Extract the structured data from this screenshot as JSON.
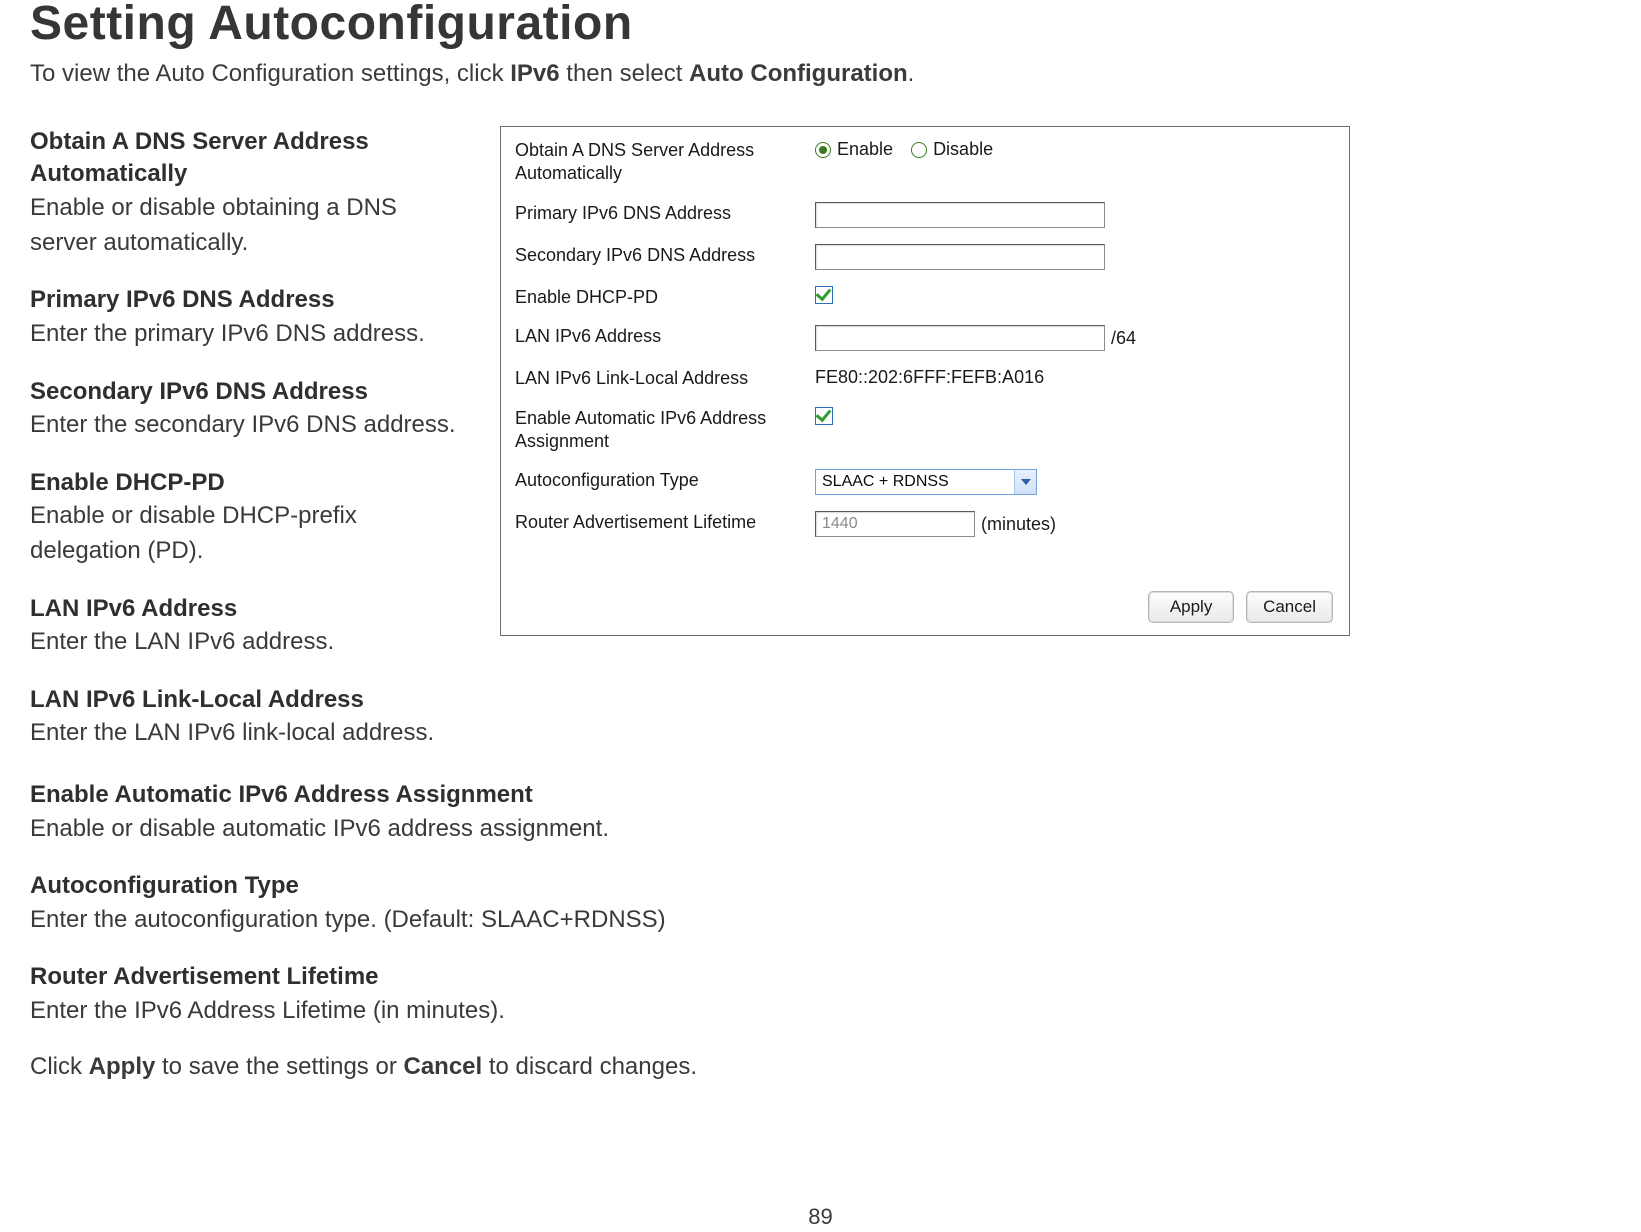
{
  "page": {
    "title": "Setting Autoconfiguration",
    "intro_prefix": "To view the Auto Configuration settings, click ",
    "intro_bold1": "IPv6",
    "intro_mid": " then select ",
    "intro_bold2": "Auto Configuration",
    "intro_suffix": ".",
    "page_number": "89"
  },
  "defs": {
    "d1_term": "Obtain A DNS Server Address Automatically",
    "d1_desc": "Enable or disable obtaining a DNS server automatically.",
    "d2_term": "Primary IPv6 DNS Address",
    "d2_desc": "Enter the primary IPv6 DNS address.",
    "d3_term": "Secondary IPv6 DNS Address",
    "d3_desc": "Enter the secondary IPv6 DNS address.",
    "d4_term": "Enable DHCP-PD",
    "d4_desc": "Enable or disable DHCP-prefix delegation (PD).",
    "d5_term": "LAN IPv6 Address",
    "d5_desc": "Enter the LAN IPv6 address.",
    "d6_term": "LAN IPv6 Link-Local Address",
    "d6_desc": "Enter the LAN IPv6 link-local address.",
    "d7_term": "Enable Automatic IPv6 Address Assignment",
    "d7_desc": "Enable or disable automatic IPv6 address assignment.",
    "d8_term": "Autoconfiguration Type",
    "d8_desc": "Enter the autoconfiguration type. (Default: SLAAC+RDNSS)",
    "d9_term": "Router Advertisement Lifetime",
    "d9_desc": "Enter the IPv6 Address Lifetime (in minutes)."
  },
  "footer": {
    "prefix": "Click ",
    "b1": "Apply",
    "mid": " to save the settings or ",
    "b2": "Cancel",
    "suffix": " to discard changes."
  },
  "panel": {
    "rows": {
      "obtain_dns_label": "Obtain A DNS Server Address Automatically",
      "radio_enable": "Enable",
      "radio_disable": "Disable",
      "primary_dns_label": "Primary IPv6 DNS Address",
      "primary_dns_value": "",
      "secondary_dns_label": "Secondary IPv6 DNS Address",
      "secondary_dns_value": "",
      "enable_dhcp_pd_label": "Enable DHCP-PD",
      "lan_ipv6_label": "LAN IPv6 Address",
      "lan_ipv6_value": "",
      "lan_ipv6_suffix": "/64",
      "link_local_label": "LAN IPv6 Link-Local Address",
      "link_local_value": "FE80::202:6FFF:FEFB:A016",
      "enable_auto_assign_label": "Enable Automatic IPv6 Address Assignment",
      "autoconfig_type_label": "Autoconfiguration Type",
      "autoconfig_type_value": "SLAAC + RDNSS",
      "ra_lifetime_label": "Router Advertisement Lifetime",
      "ra_lifetime_value": "1440",
      "ra_lifetime_unit": "(minutes)"
    },
    "buttons": {
      "apply": "Apply",
      "cancel": "Cancel"
    }
  }
}
